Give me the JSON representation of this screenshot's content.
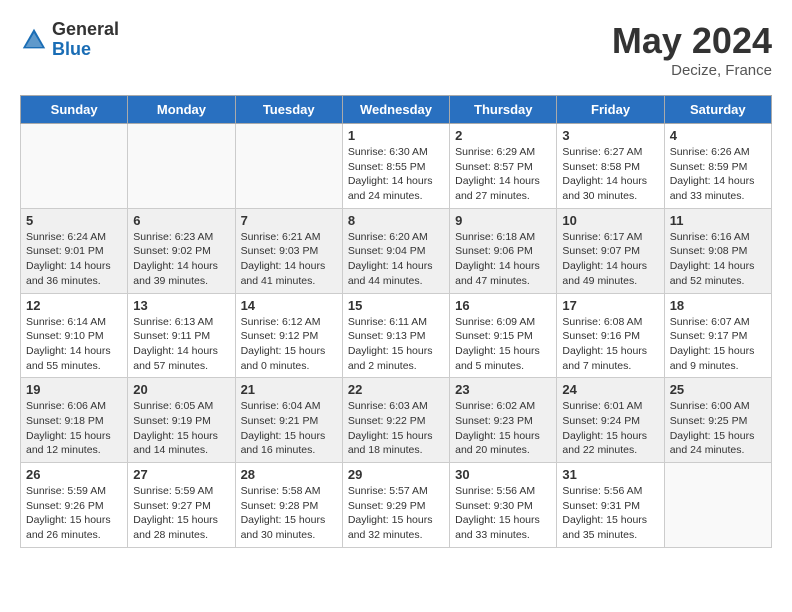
{
  "header": {
    "logo_general": "General",
    "logo_blue": "Blue",
    "month_year": "May 2024",
    "location": "Decize, France"
  },
  "days_of_week": [
    "Sunday",
    "Monday",
    "Tuesday",
    "Wednesday",
    "Thursday",
    "Friday",
    "Saturday"
  ],
  "weeks": [
    [
      {
        "day": "",
        "info": ""
      },
      {
        "day": "",
        "info": ""
      },
      {
        "day": "",
        "info": ""
      },
      {
        "day": "1",
        "info": "Sunrise: 6:30 AM\nSunset: 8:55 PM\nDaylight: 14 hours\nand 24 minutes."
      },
      {
        "day": "2",
        "info": "Sunrise: 6:29 AM\nSunset: 8:57 PM\nDaylight: 14 hours\nand 27 minutes."
      },
      {
        "day": "3",
        "info": "Sunrise: 6:27 AM\nSunset: 8:58 PM\nDaylight: 14 hours\nand 30 minutes."
      },
      {
        "day": "4",
        "info": "Sunrise: 6:26 AM\nSunset: 8:59 PM\nDaylight: 14 hours\nand 33 minutes."
      }
    ],
    [
      {
        "day": "5",
        "info": "Sunrise: 6:24 AM\nSunset: 9:01 PM\nDaylight: 14 hours\nand 36 minutes."
      },
      {
        "day": "6",
        "info": "Sunrise: 6:23 AM\nSunset: 9:02 PM\nDaylight: 14 hours\nand 39 minutes."
      },
      {
        "day": "7",
        "info": "Sunrise: 6:21 AM\nSunset: 9:03 PM\nDaylight: 14 hours\nand 41 minutes."
      },
      {
        "day": "8",
        "info": "Sunrise: 6:20 AM\nSunset: 9:04 PM\nDaylight: 14 hours\nand 44 minutes."
      },
      {
        "day": "9",
        "info": "Sunrise: 6:18 AM\nSunset: 9:06 PM\nDaylight: 14 hours\nand 47 minutes."
      },
      {
        "day": "10",
        "info": "Sunrise: 6:17 AM\nSunset: 9:07 PM\nDaylight: 14 hours\nand 49 minutes."
      },
      {
        "day": "11",
        "info": "Sunrise: 6:16 AM\nSunset: 9:08 PM\nDaylight: 14 hours\nand 52 minutes."
      }
    ],
    [
      {
        "day": "12",
        "info": "Sunrise: 6:14 AM\nSunset: 9:10 PM\nDaylight: 14 hours\nand 55 minutes."
      },
      {
        "day": "13",
        "info": "Sunrise: 6:13 AM\nSunset: 9:11 PM\nDaylight: 14 hours\nand 57 minutes."
      },
      {
        "day": "14",
        "info": "Sunrise: 6:12 AM\nSunset: 9:12 PM\nDaylight: 15 hours\nand 0 minutes."
      },
      {
        "day": "15",
        "info": "Sunrise: 6:11 AM\nSunset: 9:13 PM\nDaylight: 15 hours\nand 2 minutes."
      },
      {
        "day": "16",
        "info": "Sunrise: 6:09 AM\nSunset: 9:15 PM\nDaylight: 15 hours\nand 5 minutes."
      },
      {
        "day": "17",
        "info": "Sunrise: 6:08 AM\nSunset: 9:16 PM\nDaylight: 15 hours\nand 7 minutes."
      },
      {
        "day": "18",
        "info": "Sunrise: 6:07 AM\nSunset: 9:17 PM\nDaylight: 15 hours\nand 9 minutes."
      }
    ],
    [
      {
        "day": "19",
        "info": "Sunrise: 6:06 AM\nSunset: 9:18 PM\nDaylight: 15 hours\nand 12 minutes."
      },
      {
        "day": "20",
        "info": "Sunrise: 6:05 AM\nSunset: 9:19 PM\nDaylight: 15 hours\nand 14 minutes."
      },
      {
        "day": "21",
        "info": "Sunrise: 6:04 AM\nSunset: 9:21 PM\nDaylight: 15 hours\nand 16 minutes."
      },
      {
        "day": "22",
        "info": "Sunrise: 6:03 AM\nSunset: 9:22 PM\nDaylight: 15 hours\nand 18 minutes."
      },
      {
        "day": "23",
        "info": "Sunrise: 6:02 AM\nSunset: 9:23 PM\nDaylight: 15 hours\nand 20 minutes."
      },
      {
        "day": "24",
        "info": "Sunrise: 6:01 AM\nSunset: 9:24 PM\nDaylight: 15 hours\nand 22 minutes."
      },
      {
        "day": "25",
        "info": "Sunrise: 6:00 AM\nSunset: 9:25 PM\nDaylight: 15 hours\nand 24 minutes."
      }
    ],
    [
      {
        "day": "26",
        "info": "Sunrise: 5:59 AM\nSunset: 9:26 PM\nDaylight: 15 hours\nand 26 minutes."
      },
      {
        "day": "27",
        "info": "Sunrise: 5:59 AM\nSunset: 9:27 PM\nDaylight: 15 hours\nand 28 minutes."
      },
      {
        "day": "28",
        "info": "Sunrise: 5:58 AM\nSunset: 9:28 PM\nDaylight: 15 hours\nand 30 minutes."
      },
      {
        "day": "29",
        "info": "Sunrise: 5:57 AM\nSunset: 9:29 PM\nDaylight: 15 hours\nand 32 minutes."
      },
      {
        "day": "30",
        "info": "Sunrise: 5:56 AM\nSunset: 9:30 PM\nDaylight: 15 hours\nand 33 minutes."
      },
      {
        "day": "31",
        "info": "Sunrise: 5:56 AM\nSunset: 9:31 PM\nDaylight: 15 hours\nand 35 minutes."
      },
      {
        "day": "",
        "info": ""
      }
    ]
  ]
}
